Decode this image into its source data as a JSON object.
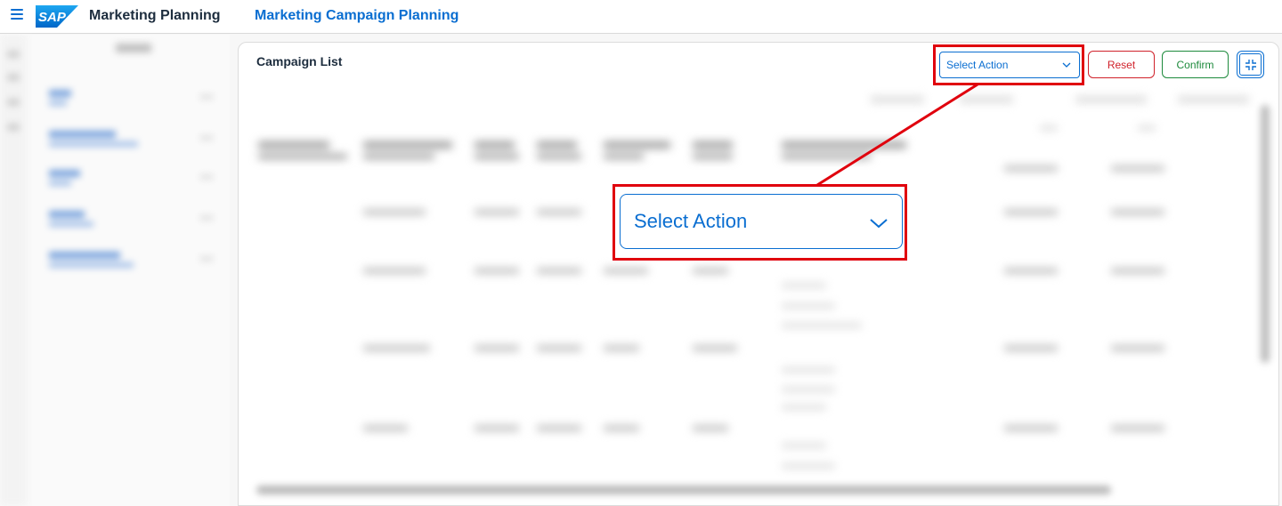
{
  "header": {
    "menu_icon": "hamburger-icon",
    "logo_text": "SAP",
    "app_title": "Marketing Planning",
    "page_title": "Marketing Campaign Planning"
  },
  "card": {
    "title": "Campaign List",
    "select_action": {
      "value": "Select Action",
      "icon": "chevron-down-icon"
    },
    "reset_label": "Reset",
    "confirm_label": "Confirm",
    "fullscreen_icon": "exit-fullscreen-icon"
  },
  "callout": {
    "select_action_zoom": "Select Action"
  },
  "colors": {
    "brand_blue": "#0a6ed1",
    "reset_red": "#d0212a",
    "confirm_green": "#1d8a3c",
    "highlight_red": "#e0000d"
  }
}
